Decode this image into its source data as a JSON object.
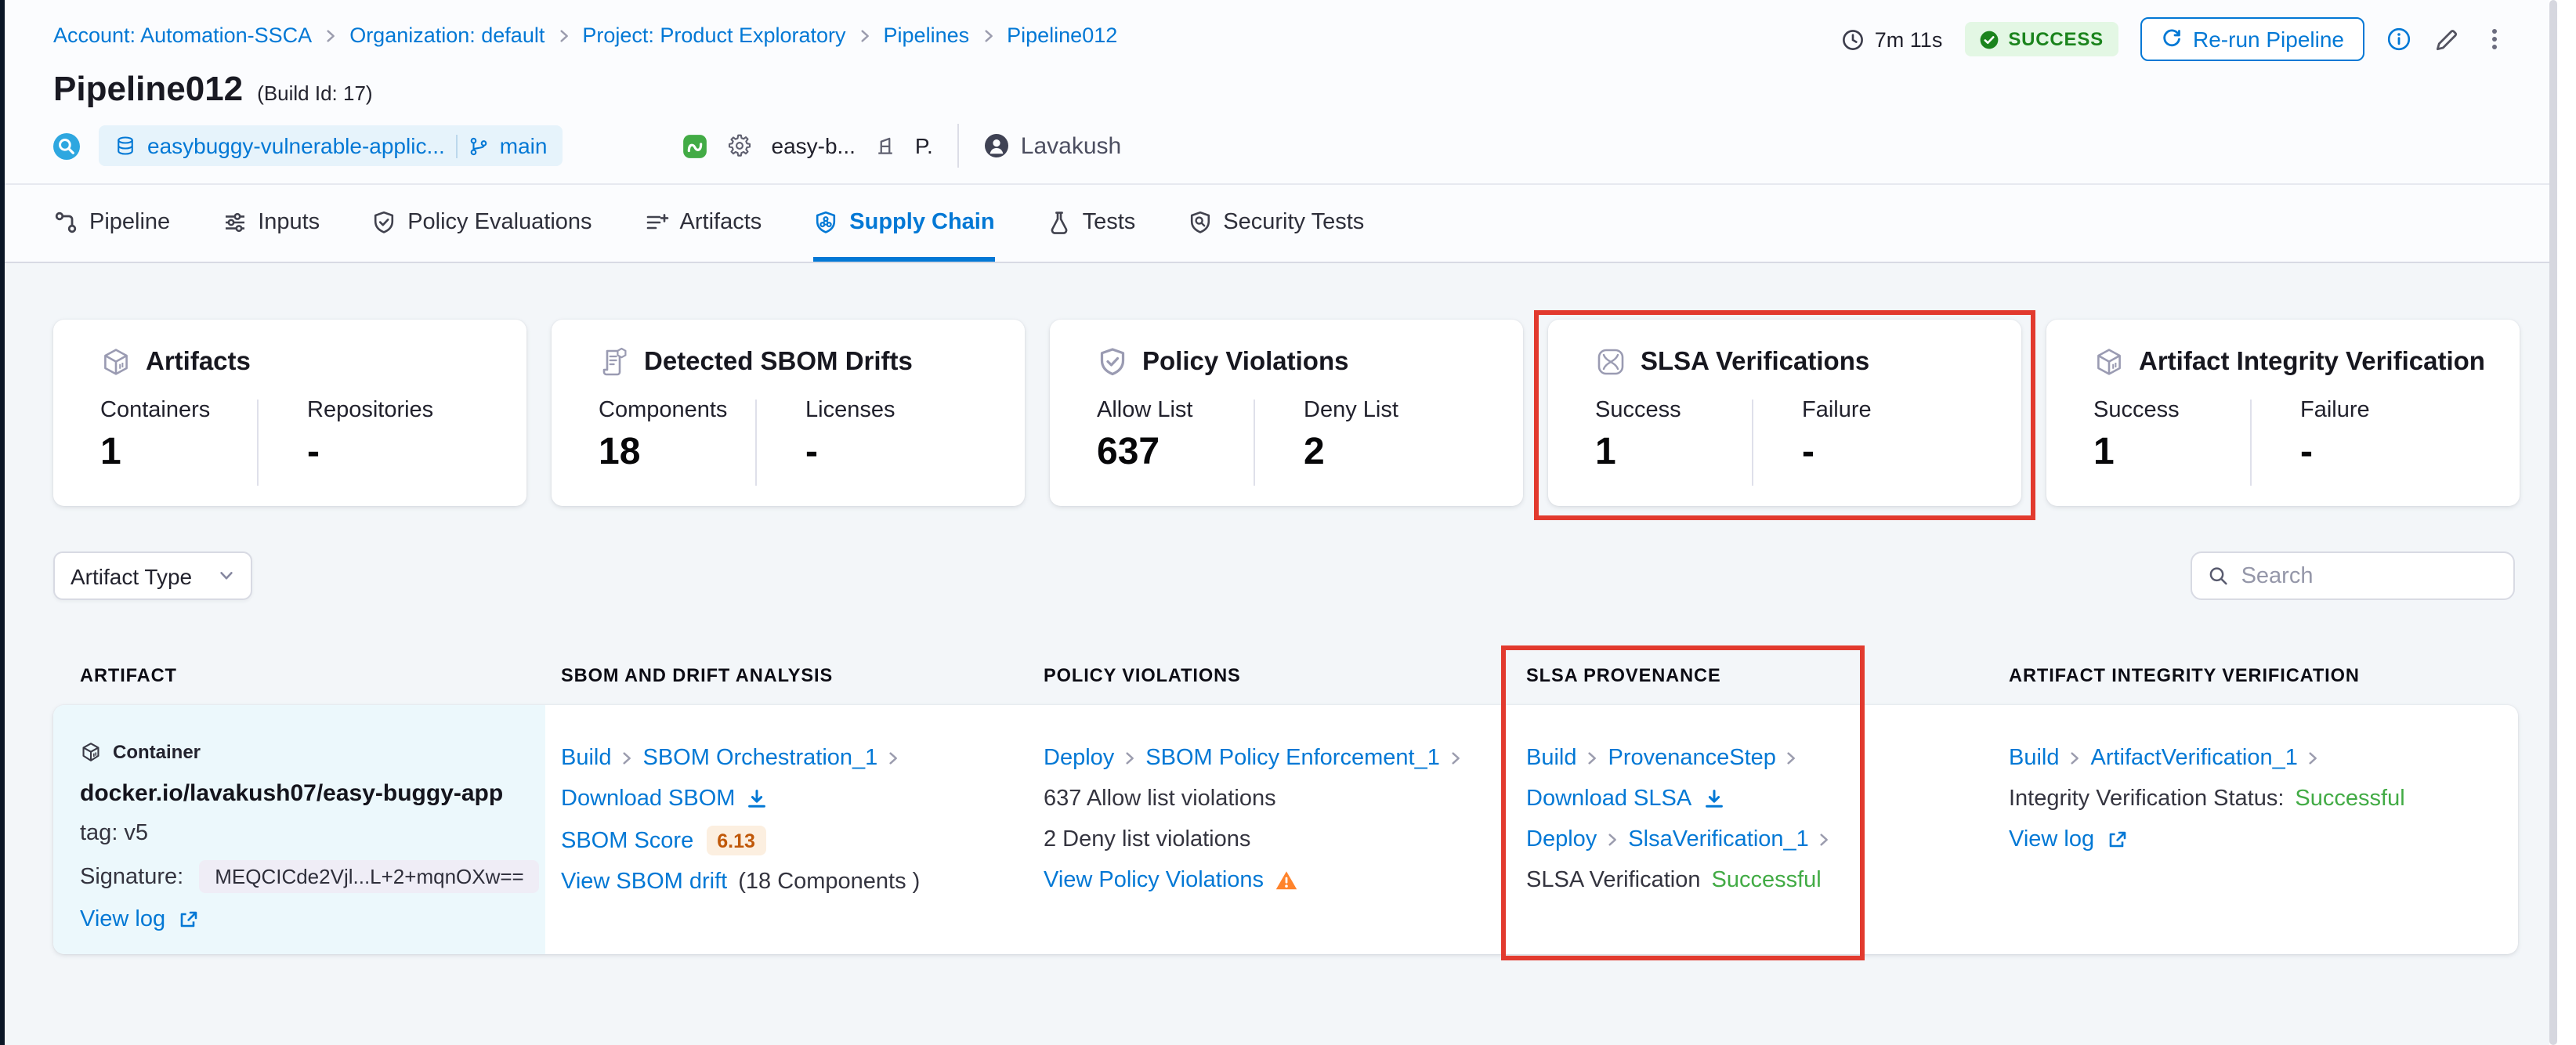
{
  "colors": {
    "accent": "#0278d5",
    "success_badge_bg": "#e3f7e4",
    "success_badge_text": "#1b841d",
    "status_green": "#42ab45",
    "warning_orange": "#ff832b",
    "score_bg": "#fcefe0",
    "score_text": "#c05809",
    "annotation_red": "#e23a2e"
  },
  "breadcrumb": {
    "items": [
      "Account: Automation-SSCA",
      "Organization: default",
      "Project: Product Exploratory",
      "Pipelines",
      "Pipeline012"
    ]
  },
  "toolbar": {
    "duration": "7m 11s",
    "status": "SUCCESS",
    "rerun_label": "Re-run Pipeline"
  },
  "title": {
    "name": "Pipeline012",
    "build": "(Build Id: 17)"
  },
  "context": {
    "repo": "easybuggy-vulnerable-applic...",
    "branch": "main",
    "service": "easy-b...",
    "registry_abbrev": "P.",
    "user": "Lavakush"
  },
  "tabs": [
    {
      "label": "Pipeline"
    },
    {
      "label": "Inputs"
    },
    {
      "label": "Policy Evaluations"
    },
    {
      "label": "Artifacts"
    },
    {
      "label": "Supply Chain"
    },
    {
      "label": "Tests"
    },
    {
      "label": "Security Tests"
    }
  ],
  "cards": [
    {
      "title": "Artifacts",
      "cols": [
        {
          "label": "Containers",
          "value": "1"
        },
        {
          "label": "Repositories",
          "value": "-"
        }
      ]
    },
    {
      "title": "Detected SBOM Drifts",
      "cols": [
        {
          "label": "Components",
          "value": "18"
        },
        {
          "label": "Licenses",
          "value": "-"
        }
      ]
    },
    {
      "title": "Policy Violations",
      "cols": [
        {
          "label": "Allow List",
          "value": "637"
        },
        {
          "label": "Deny List",
          "value": "2"
        }
      ]
    },
    {
      "title": "SLSA Verifications",
      "cols": [
        {
          "label": "Success",
          "value": "1"
        },
        {
          "label": "Failure",
          "value": "-"
        }
      ]
    },
    {
      "title": "Artifact Integrity Verification",
      "cols": [
        {
          "label": "Success",
          "value": "1"
        },
        {
          "label": "Failure",
          "value": "-"
        }
      ]
    }
  ],
  "filters": {
    "artifact_type": "Artifact Type",
    "search_placeholder": "Search"
  },
  "table": {
    "headers": [
      "ARTIFACT",
      "SBOM AND DRIFT ANALYSIS",
      "POLICY VIOLATIONS",
      "SLSA PROVENANCE",
      "ARTIFACT INTEGRITY VERIFICATION"
    ],
    "row": {
      "artifact": {
        "type_label": "Container",
        "image": "docker.io/lavakush07/easy-buggy-app",
        "tag": "tag: v5",
        "signature_label": "Signature:",
        "signature_value": "MEQCICde2Vjl...L+2+mqnOXw==",
        "view_log": "View log"
      },
      "sbom": {
        "stage": "Build",
        "step": "SBOM Orchestration_1",
        "download": "Download SBOM",
        "score_label": "SBOM Score",
        "score": "6.13",
        "drift_link": "View SBOM drift",
        "drift_suffix": "(18 Components )"
      },
      "policy": {
        "stage": "Deploy",
        "step": "SBOM Policy Enforcement_1",
        "allow": "637 Allow list violations",
        "deny": "2 Deny list violations",
        "view": "View Policy Violations"
      },
      "slsa": {
        "stage1": "Build",
        "step1": "ProvenanceStep",
        "download": "Download SLSA",
        "stage2": "Deploy",
        "step2": "SlsaVerification_1",
        "status_label": "SLSA Verification",
        "status_value": "Successful"
      },
      "integrity": {
        "stage": "Build",
        "step": "ArtifactVerification_1",
        "status_label": "Integrity Verification Status:",
        "status_value": "Successful",
        "view_log": "View log"
      }
    }
  }
}
